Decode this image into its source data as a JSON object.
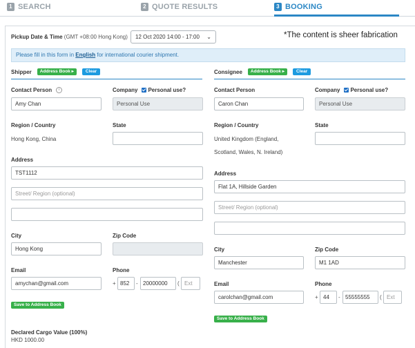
{
  "steps": [
    {
      "num": "1",
      "label": "SEARCH"
    },
    {
      "num": "2",
      "label": "QUOTE RESULTS"
    },
    {
      "num": "3",
      "label": "BOOKING"
    }
  ],
  "pickup": {
    "label": "Pickup Date & Time",
    "timezone": "(GMT +08:00 Hong Kong)",
    "value": "12 Oct 2020 14:00 - 17:00"
  },
  "notice_overlay": "*The content is sheer fabrication",
  "info_bar": {
    "prefix": "Please fill in this form in ",
    "lang": "English",
    "suffix": " for international courier shipment."
  },
  "shipper": {
    "title": "Shipper",
    "address_book_label": "Address Book ▸",
    "clear_label": "Clear",
    "contact_label": "Contact Person",
    "contact_value": "Amy Chan",
    "company_label": "Company",
    "personal_use_label": "Personal use?",
    "company_value": "Personal Use",
    "region_label": "Region / Country",
    "region_value": "Hong Kong, China",
    "state_label": "State",
    "state_value": "",
    "address_label": "Address",
    "address1": "TST1112",
    "address2_placeholder": "Street/ Region (optional)",
    "address3": "",
    "city_label": "City",
    "city_value": "Hong Kong",
    "zip_label": "Zip Code",
    "zip_value": "",
    "email_label": "Email",
    "email_value": "amychan@gmail.com",
    "phone_label": "Phone",
    "phone_plus": "+",
    "phone_code": "852",
    "phone_dash": "-",
    "phone_number": "20000000",
    "phone_paren": "(",
    "phone_ext": "Ext",
    "save_label": "Save to Address Book"
  },
  "consignee": {
    "title": "Consignee",
    "address_book_label": "Address Book ▸",
    "clear_label": "Clear",
    "contact_label": "Contact Person",
    "contact_value": "Caron Chan",
    "company_label": "Company",
    "personal_use_label": "Personal use?",
    "company_value": "Personal Use",
    "region_label": "Region / Country",
    "region_line1": "United Kingdom (England,",
    "region_line2": "Scotland, Wales, N. Ireland)",
    "state_label": "State",
    "state_value": "",
    "address_label": "Address",
    "address1": "Flat 1A, Hillside Garden",
    "address2_placeholder": "Street/ Region (optional)",
    "address3": "",
    "city_label": "City",
    "city_value": "Manchester",
    "zip_label": "Zip Code",
    "zip_value": "M1 1AD",
    "email_label": "Email",
    "email_value": "carolchan@gmail.com",
    "phone_label": "Phone",
    "phone_plus": "+",
    "phone_code": "44",
    "phone_dash": "-",
    "phone_number": "55555555",
    "phone_paren": "(",
    "phone_ext": "Ext",
    "save_label": "Save to Address Book"
  },
  "cargo": {
    "label": "Declared Cargo Value (100%)",
    "value": "HKD 1000.00"
  },
  "colors": {
    "accent": "#2b87c5",
    "green": "#38b04a",
    "blue_btn": "#1d9be0",
    "info_bg": "#dfeef9"
  }
}
